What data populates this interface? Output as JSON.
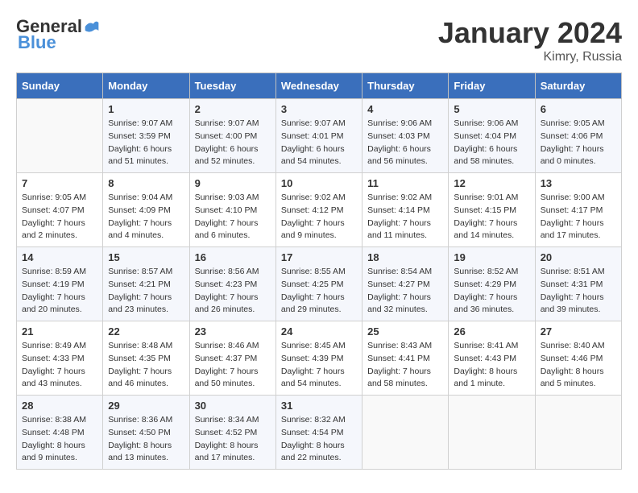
{
  "header": {
    "logo_general": "General",
    "logo_blue": "Blue",
    "title": "January 2024",
    "subtitle": "Kimry, Russia"
  },
  "days_of_week": [
    "Sunday",
    "Monday",
    "Tuesday",
    "Wednesday",
    "Thursday",
    "Friday",
    "Saturday"
  ],
  "weeks": [
    [
      {
        "day": "",
        "sunrise": "",
        "sunset": "",
        "daylight": ""
      },
      {
        "day": "1",
        "sunrise": "Sunrise: 9:07 AM",
        "sunset": "Sunset: 3:59 PM",
        "daylight": "Daylight: 6 hours and 51 minutes."
      },
      {
        "day": "2",
        "sunrise": "Sunrise: 9:07 AM",
        "sunset": "Sunset: 4:00 PM",
        "daylight": "Daylight: 6 hours and 52 minutes."
      },
      {
        "day": "3",
        "sunrise": "Sunrise: 9:07 AM",
        "sunset": "Sunset: 4:01 PM",
        "daylight": "Daylight: 6 hours and 54 minutes."
      },
      {
        "day": "4",
        "sunrise": "Sunrise: 9:06 AM",
        "sunset": "Sunset: 4:03 PM",
        "daylight": "Daylight: 6 hours and 56 minutes."
      },
      {
        "day": "5",
        "sunrise": "Sunrise: 9:06 AM",
        "sunset": "Sunset: 4:04 PM",
        "daylight": "Daylight: 6 hours and 58 minutes."
      },
      {
        "day": "6",
        "sunrise": "Sunrise: 9:05 AM",
        "sunset": "Sunset: 4:06 PM",
        "daylight": "Daylight: 7 hours and 0 minutes."
      }
    ],
    [
      {
        "day": "7",
        "sunrise": "Sunrise: 9:05 AM",
        "sunset": "Sunset: 4:07 PM",
        "daylight": "Daylight: 7 hours and 2 minutes."
      },
      {
        "day": "8",
        "sunrise": "Sunrise: 9:04 AM",
        "sunset": "Sunset: 4:09 PM",
        "daylight": "Daylight: 7 hours and 4 minutes."
      },
      {
        "day": "9",
        "sunrise": "Sunrise: 9:03 AM",
        "sunset": "Sunset: 4:10 PM",
        "daylight": "Daylight: 7 hours and 6 minutes."
      },
      {
        "day": "10",
        "sunrise": "Sunrise: 9:02 AM",
        "sunset": "Sunset: 4:12 PM",
        "daylight": "Daylight: 7 hours and 9 minutes."
      },
      {
        "day": "11",
        "sunrise": "Sunrise: 9:02 AM",
        "sunset": "Sunset: 4:14 PM",
        "daylight": "Daylight: 7 hours and 11 minutes."
      },
      {
        "day": "12",
        "sunrise": "Sunrise: 9:01 AM",
        "sunset": "Sunset: 4:15 PM",
        "daylight": "Daylight: 7 hours and 14 minutes."
      },
      {
        "day": "13",
        "sunrise": "Sunrise: 9:00 AM",
        "sunset": "Sunset: 4:17 PM",
        "daylight": "Daylight: 7 hours and 17 minutes."
      }
    ],
    [
      {
        "day": "14",
        "sunrise": "Sunrise: 8:59 AM",
        "sunset": "Sunset: 4:19 PM",
        "daylight": "Daylight: 7 hours and 20 minutes."
      },
      {
        "day": "15",
        "sunrise": "Sunrise: 8:57 AM",
        "sunset": "Sunset: 4:21 PM",
        "daylight": "Daylight: 7 hours and 23 minutes."
      },
      {
        "day": "16",
        "sunrise": "Sunrise: 8:56 AM",
        "sunset": "Sunset: 4:23 PM",
        "daylight": "Daylight: 7 hours and 26 minutes."
      },
      {
        "day": "17",
        "sunrise": "Sunrise: 8:55 AM",
        "sunset": "Sunset: 4:25 PM",
        "daylight": "Daylight: 7 hours and 29 minutes."
      },
      {
        "day": "18",
        "sunrise": "Sunrise: 8:54 AM",
        "sunset": "Sunset: 4:27 PM",
        "daylight": "Daylight: 7 hours and 32 minutes."
      },
      {
        "day": "19",
        "sunrise": "Sunrise: 8:52 AM",
        "sunset": "Sunset: 4:29 PM",
        "daylight": "Daylight: 7 hours and 36 minutes."
      },
      {
        "day": "20",
        "sunrise": "Sunrise: 8:51 AM",
        "sunset": "Sunset: 4:31 PM",
        "daylight": "Daylight: 7 hours and 39 minutes."
      }
    ],
    [
      {
        "day": "21",
        "sunrise": "Sunrise: 8:49 AM",
        "sunset": "Sunset: 4:33 PM",
        "daylight": "Daylight: 7 hours and 43 minutes."
      },
      {
        "day": "22",
        "sunrise": "Sunrise: 8:48 AM",
        "sunset": "Sunset: 4:35 PM",
        "daylight": "Daylight: 7 hours and 46 minutes."
      },
      {
        "day": "23",
        "sunrise": "Sunrise: 8:46 AM",
        "sunset": "Sunset: 4:37 PM",
        "daylight": "Daylight: 7 hours and 50 minutes."
      },
      {
        "day": "24",
        "sunrise": "Sunrise: 8:45 AM",
        "sunset": "Sunset: 4:39 PM",
        "daylight": "Daylight: 7 hours and 54 minutes."
      },
      {
        "day": "25",
        "sunrise": "Sunrise: 8:43 AM",
        "sunset": "Sunset: 4:41 PM",
        "daylight": "Daylight: 7 hours and 58 minutes."
      },
      {
        "day": "26",
        "sunrise": "Sunrise: 8:41 AM",
        "sunset": "Sunset: 4:43 PM",
        "daylight": "Daylight: 8 hours and 1 minute."
      },
      {
        "day": "27",
        "sunrise": "Sunrise: 8:40 AM",
        "sunset": "Sunset: 4:46 PM",
        "daylight": "Daylight: 8 hours and 5 minutes."
      }
    ],
    [
      {
        "day": "28",
        "sunrise": "Sunrise: 8:38 AM",
        "sunset": "Sunset: 4:48 PM",
        "daylight": "Daylight: 8 hours and 9 minutes."
      },
      {
        "day": "29",
        "sunrise": "Sunrise: 8:36 AM",
        "sunset": "Sunset: 4:50 PM",
        "daylight": "Daylight: 8 hours and 13 minutes."
      },
      {
        "day": "30",
        "sunrise": "Sunrise: 8:34 AM",
        "sunset": "Sunset: 4:52 PM",
        "daylight": "Daylight: 8 hours and 17 minutes."
      },
      {
        "day": "31",
        "sunrise": "Sunrise: 8:32 AM",
        "sunset": "Sunset: 4:54 PM",
        "daylight": "Daylight: 8 hours and 22 minutes."
      },
      {
        "day": "",
        "sunrise": "",
        "sunset": "",
        "daylight": ""
      },
      {
        "day": "",
        "sunrise": "",
        "sunset": "",
        "daylight": ""
      },
      {
        "day": "",
        "sunrise": "",
        "sunset": "",
        "daylight": ""
      }
    ]
  ]
}
